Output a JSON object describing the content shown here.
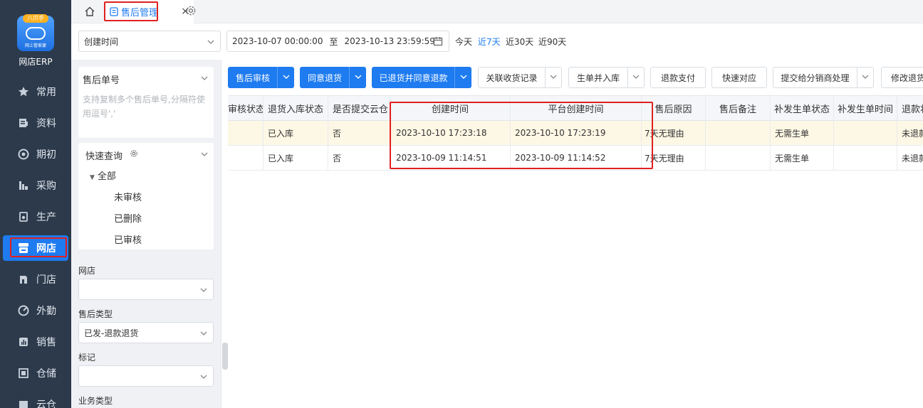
{
  "app": {
    "logo_badge": "八爪手",
    "logo_sub": "网上管家婆",
    "name": "网店ERP"
  },
  "nav": [
    {
      "label": "常用",
      "icon": "star-icon"
    },
    {
      "label": "资料",
      "icon": "profile-icon"
    },
    {
      "label": "期初",
      "icon": "target-icon"
    },
    {
      "label": "采购",
      "icon": "purchase-icon"
    },
    {
      "label": "生产",
      "icon": "production-icon"
    },
    {
      "label": "网店",
      "icon": "store-icon",
      "active": true
    },
    {
      "label": "门店",
      "icon": "shop-icon"
    },
    {
      "label": "外勤",
      "icon": "fieldwork-icon"
    },
    {
      "label": "销售",
      "icon": "sales-icon"
    },
    {
      "label": "仓储",
      "icon": "warehouse-icon"
    },
    {
      "label": "云仓",
      "icon": "cloud-warehouse-icon"
    }
  ],
  "tabs": {
    "active_label": "售后管理",
    "close": "×"
  },
  "filters": {
    "date_field": "创建时间",
    "date_start": "2023-10-07 00:00:00",
    "date_sep": "至",
    "date_end": "2023-10-13 23:59:59",
    "quick": [
      "今天",
      "近7天",
      "近30天",
      "近90天"
    ],
    "quick_active_index": 1
  },
  "side": {
    "order_no_label": "售后单号",
    "order_no_placeholder": "支持复制多个售后单号,分隔符使用逗号','",
    "quick_query_label": "快速查询",
    "tree_root": "全部",
    "tree_items": [
      "未审核",
      "已删除",
      "已审核"
    ],
    "store_label": "网店",
    "store_value": "",
    "aftersale_type_label": "售后类型",
    "aftersale_type_value": "已发-退款退货",
    "mark_label": "标记",
    "mark_value": "",
    "biz_type_label": "业务类型"
  },
  "toolbar": {
    "buttons": [
      {
        "label": "售后审核",
        "type": "primary",
        "dropdown": true
      },
      {
        "label": "同意退货",
        "type": "primary",
        "dropdown": true
      },
      {
        "label": "已退货并同意退款",
        "type": "primary",
        "dropdown": true
      },
      {
        "label": "关联收货记录",
        "type": "default",
        "dropdown": true
      },
      {
        "label": "生单并入库",
        "type": "default",
        "dropdown": true
      },
      {
        "label": "退款支付",
        "type": "default",
        "dropdown": false
      },
      {
        "label": "快速对应",
        "type": "default",
        "dropdown": false
      },
      {
        "label": "提交给分销商处理",
        "type": "default",
        "dropdown": true
      },
      {
        "label": "修改退货",
        "type": "default",
        "dropdown": false
      }
    ]
  },
  "table": {
    "columns": [
      "审核状态",
      "退货入库状态",
      "是否提交云仓",
      "创建时间",
      "平台创建时间",
      "售后原因",
      "售后备注",
      "补发生单状态",
      "补发生单时间",
      "退款状"
    ],
    "rows": [
      [
        "",
        "已入库",
        "否",
        "2023-10-10 17:23:18",
        "2023-10-10 17:23:19",
        "7天无理由",
        "",
        "无需生单",
        "",
        "未退款"
      ],
      [
        "",
        "已入库",
        "否",
        "2023-10-09 11:14:51",
        "2023-10-09 11:14:52",
        "7天无理由",
        "",
        "无需生单",
        "",
        "未退款"
      ]
    ],
    "selected_row_index": 0
  }
}
